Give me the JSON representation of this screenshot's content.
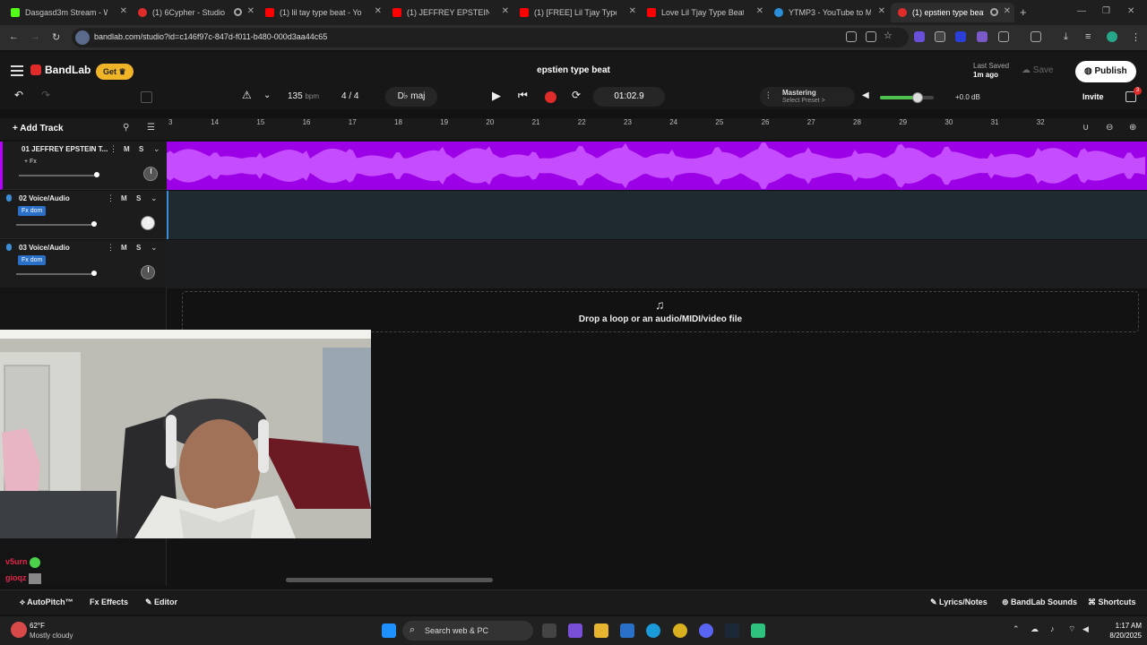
{
  "browser": {
    "tabs": [
      {
        "title": "Dasgasd3m Stream - Watc",
        "favicon_color": "#53fc18"
      },
      {
        "title": "(1) 6Cypher - Studio",
        "favicon_color": "#e02b2b"
      },
      {
        "title": "(1) lil tay type beat - YouT",
        "favicon_color": "#ff0000"
      },
      {
        "title": "(1) JEFFREY EPSTEIN TYPE",
        "favicon_color": "#ff0000"
      },
      {
        "title": "(1) [FREE] Lil Tjay Type Be",
        "favicon_color": "#ff0000"
      },
      {
        "title": "Love Lil Tjay Type Beat - Y",
        "favicon_color": "#ff0000"
      },
      {
        "title": "YTMP3 - YouTube to MP3",
        "favicon_color": "#2a8fd8"
      },
      {
        "title": "(1) epstien type beat -",
        "favicon_color": "#e02b2b"
      }
    ],
    "url": "bandlab.com/studio?id=c146f97c-847d-f011-b480-000d3aa44c65"
  },
  "bandlab": {
    "logo": "BandLab",
    "get_label": "Get",
    "project_title": "epstien type beat",
    "last_saved_label": "Last Saved",
    "last_saved_value": "1m ago",
    "save_label": "Save",
    "publish_label": "Publish",
    "invite_label": "Invite",
    "notification_count": "3",
    "transport": {
      "bpm": "135",
      "bpm_unit": "bpm",
      "time_sig": "4 / 4",
      "key": "D♭ maj",
      "time": "01:02.9",
      "mastering_label": "Mastering",
      "mastering_preset": "Select Preset >",
      "master_volume": 0.7,
      "volume_db": "+0.0 dB"
    },
    "add_track_label": "Add Track",
    "ruler": [
      "3",
      "14",
      "15",
      "16",
      "17",
      "18",
      "19",
      "20",
      "21",
      "22",
      "23",
      "24",
      "25",
      "26",
      "27",
      "28",
      "29",
      "30",
      "31",
      "32"
    ],
    "tracks": [
      {
        "name": "01  JEFFREY EPSTEIN T...",
        "fx": "+ Fx",
        "color": "#b400ff",
        "mute": "M",
        "solo": "S"
      },
      {
        "name": "02  Voice/Audio",
        "fx": "Fx dom",
        "color": "#3a8fd8",
        "mute": "M",
        "solo": "S"
      },
      {
        "name": "03  Voice/Audio",
        "fx": "Fx dom",
        "color": "#3a8fd8",
        "mute": "M",
        "solo": "S"
      }
    ],
    "drop_text": "Drop a loop or an audio/MIDI/video file",
    "bottom_bar": {
      "autopitch": "AutoPitch™",
      "effects": "Effects",
      "editor": "Editor",
      "lyrics": "Lyrics/Notes",
      "sounds": "BandLab Sounds",
      "shortcuts": "Shortcuts"
    }
  },
  "stream_chat": [
    {
      "user": "v5urn",
      "color": "#e0264a"
    },
    {
      "user": "gioqz",
      "color": "#e0264a"
    }
  ],
  "taskbar": {
    "temp": "62°F",
    "weather": "Mostly cloudy",
    "search_placeholder": "Search web & PC",
    "time": "1:17 AM",
    "date": "8/20/2025"
  }
}
